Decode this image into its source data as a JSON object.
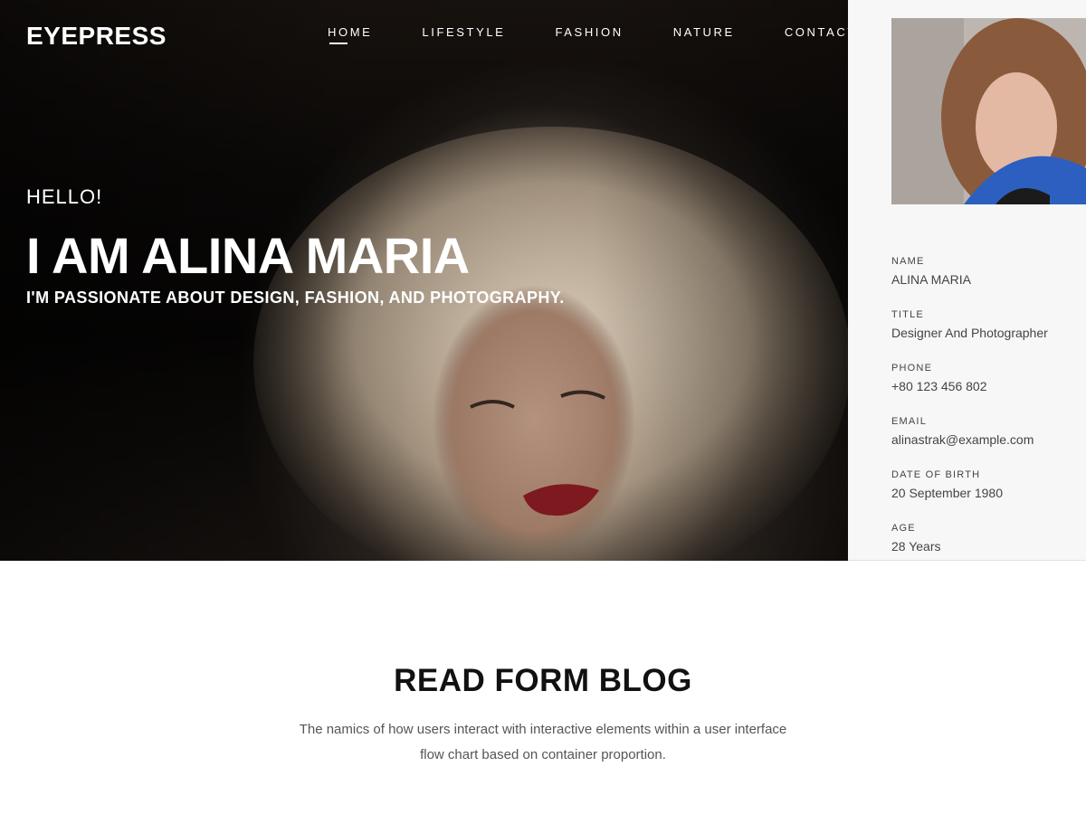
{
  "site": {
    "logo": "EYEPRESS"
  },
  "nav": {
    "items": [
      {
        "label": "HOME",
        "active": true
      },
      {
        "label": "LIFESTYLE",
        "active": false
      },
      {
        "label": "FASHION",
        "active": false
      },
      {
        "label": "NATURE",
        "active": false
      },
      {
        "label": "CONTACT",
        "active": false
      }
    ]
  },
  "hero": {
    "greeting": "HELLO!",
    "name": "I AM ALINA MARIA",
    "tagline": "I'M PASSIONATE ABOUT DESIGN, FASHION, AND PHOTOGRAPHY."
  },
  "profile": {
    "fields": [
      {
        "label": "NAME",
        "value": "ALINA MARIA"
      },
      {
        "label": "TITLE",
        "value": "Designer And Photographer"
      },
      {
        "label": "PHONE",
        "value": "+80 123 456 802"
      },
      {
        "label": "EMAIL",
        "value": "alinastrak@example.com"
      },
      {
        "label": "DATE OF BIRTH",
        "value": "20 September 1980"
      },
      {
        "label": "AGE",
        "value": "28 Years"
      }
    ]
  },
  "blog": {
    "title": "READ FORM BLOG",
    "description": "The namics of how users interact with interactive elements within a user interface flow chart based on container proportion."
  },
  "colors": {
    "hero_overlay": "#070605",
    "panel_bg": "#f7f7f7",
    "text_dark": "#111111",
    "text_muted": "#555555"
  }
}
